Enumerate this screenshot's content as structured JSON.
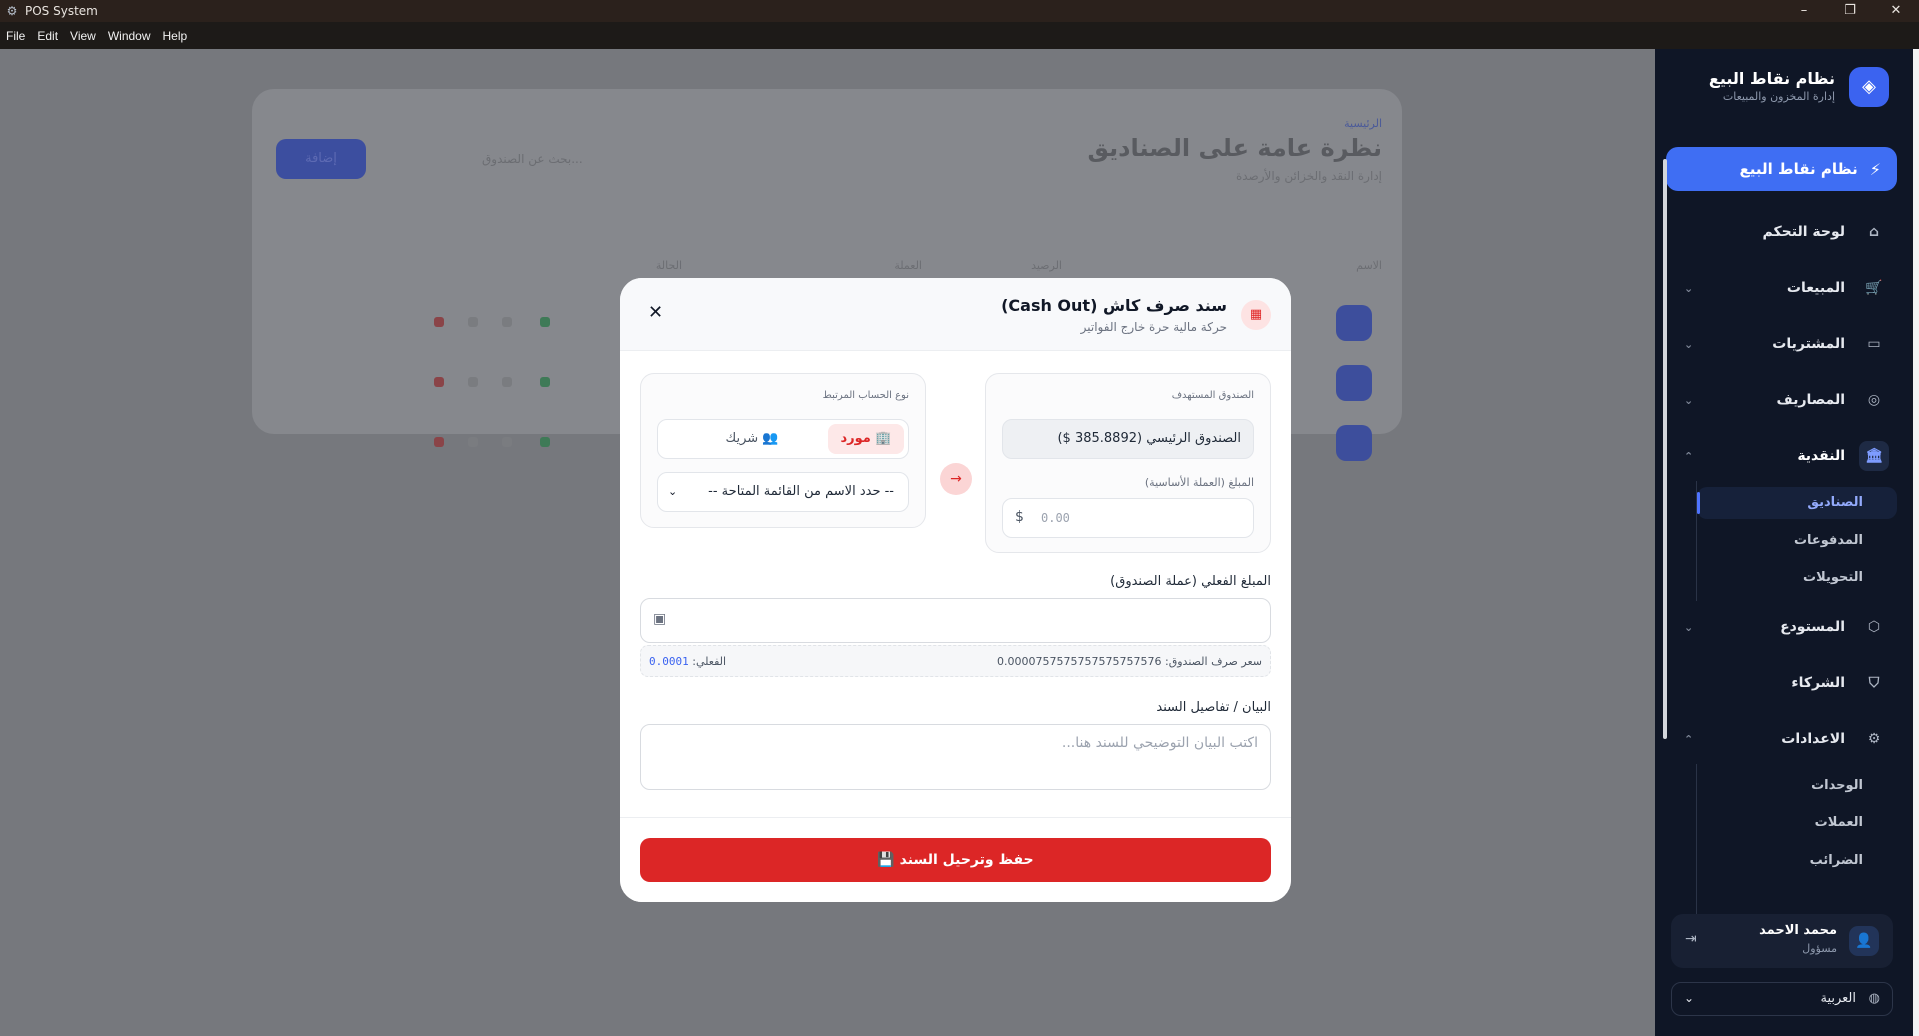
{
  "window": {
    "title": "POS System",
    "menu": [
      "File",
      "Edit",
      "View",
      "Window",
      "Help"
    ],
    "controls": {
      "minimize": "–",
      "restore": "❐",
      "close": "✕"
    }
  },
  "background": {
    "breadcrumb": "الرئيسية",
    "title": "نظرة عامة على الصناديق",
    "subtitle": "إدارة النقد والخزائن والأرصدة",
    "add_label": "إضافة",
    "search_placeholder": "بحث عن الصندوق...",
    "columns": [
      "الاسم",
      "الرصيد",
      "العملة",
      "الحالة"
    ]
  },
  "sidebar": {
    "brand_name": "نظام نقاط البيع",
    "brand_tagline": "إدارة المخزون والمبيعات",
    "pos_button": "نظام نقاط البيع",
    "items": [
      {
        "label": "لوحة التحكم",
        "icon": "home-icon",
        "glyph": "⌂"
      },
      {
        "label": "المبيعات",
        "icon": "cart-icon",
        "glyph": "🛒"
      },
      {
        "label": "المشتريات",
        "icon": "card-icon",
        "glyph": "▭"
      },
      {
        "label": "المصاريف",
        "icon": "coins-icon",
        "glyph": "◎"
      },
      {
        "label": "النقدية",
        "icon": "bank-icon",
        "glyph": "🏛"
      },
      {
        "label": "المستودع",
        "icon": "box-icon",
        "glyph": "⬡"
      },
      {
        "label": "الشركاء",
        "icon": "handshake-icon",
        "glyph": "⛉"
      },
      {
        "label": "الاعدادات",
        "icon": "gear-icon",
        "glyph": "⚙"
      }
    ],
    "cash_sub": [
      "الصناديق",
      "المدفوعات",
      "التحويلات"
    ],
    "settings_sub": [
      "الوحدات",
      "العملات",
      "الضرائب"
    ],
    "user_name": "محمد الاحمد",
    "user_role": "مسؤول",
    "language": "العربية"
  },
  "modal": {
    "title": "سند صرف كاش (Cash Out)",
    "subtitle": "حركة مالية حرة خارج الفواتير",
    "target_cashbox_label": "الصندوق المستهدف",
    "target_cashbox_value": "الصندوق الرئيسي (385.8892 $)",
    "base_amount_label": "المبلغ (العملة الأساسية)",
    "base_amount_placeholder": "0.00",
    "currency_symbol": "$",
    "account_type_label": "نوع الحساب المرتبط",
    "account_types": [
      "مورد",
      "شريك"
    ],
    "name_select": "-- حدد الاسم من القائمة المتاحة --",
    "actual_amount_label": "المبلغ الفعلي (عملة الصندوق)",
    "rate_label": "سعر صرف الصندوق:",
    "rate_value": "0.0000757575757575757576",
    "actual_label": "الفعلي:",
    "actual_value": "0.0001",
    "description_label": "البيان / تفاصيل السند",
    "description_placeholder": "اكتب البيان التوضيحي للسند هنا...",
    "save_button": "حفظ وترحيل السند"
  },
  "colors": {
    "accent": "#3f6ef3",
    "danger": "#dc2626",
    "sidebar_bg": "#0f1626"
  }
}
